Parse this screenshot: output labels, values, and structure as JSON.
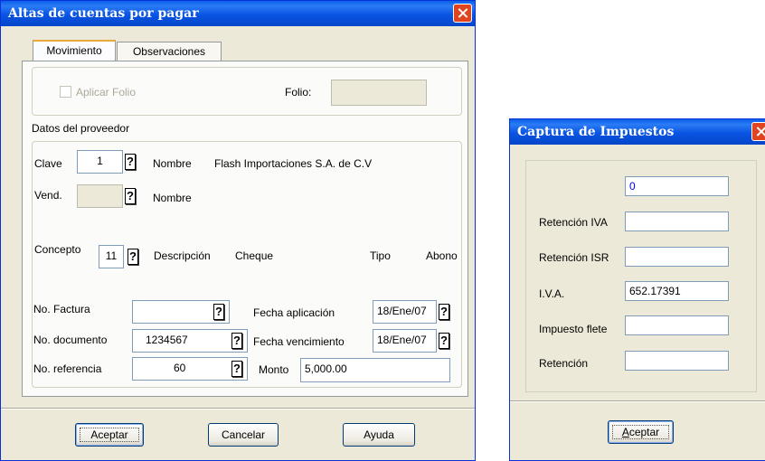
{
  "main_window": {
    "title": "Altas de cuentas por pagar",
    "tabs": [
      "Movimiento",
      "Observaciones"
    ],
    "aplicar_folio_label": "Aplicar Folio",
    "folio_label": "Folio:",
    "folio_value": "",
    "proveedor_section": "Datos del proveedor",
    "clave_label": "Clave",
    "clave_value": "1",
    "nombre_label": "Nombre",
    "nombre_value": "Flash Importaciones S.A. de C.V",
    "vend_label": "Vend.",
    "vend_value": "",
    "vend_nombre_label": "Nombre",
    "concepto_label": "Concepto",
    "concepto_value": "11",
    "descripcion_label": "Descripción",
    "descripcion_value": "Cheque",
    "tipo_label": "Tipo",
    "tipo_value": "Abono",
    "factura_label": "No. Factura",
    "factura_value": "",
    "documento_label": "No. documento",
    "documento_value": "1234567",
    "referencia_label": "No. referencia",
    "referencia_value": "60",
    "fecha_aplicacion_label": "Fecha aplicación",
    "fecha_aplicacion_value": "18/Ene/07",
    "fecha_vencimiento_label": "Fecha vencimiento",
    "fecha_vencimiento_value": "18/Ene/07",
    "monto_label": "Monto",
    "monto_value": "5,000.00",
    "help_glyph": "?",
    "buttons": {
      "accept": "Aceptar",
      "cancel": "Cancelar",
      "help": "Ayuda"
    }
  },
  "tax_dialog": {
    "title": "Captura de Impuestos",
    "first_value": "0",
    "retencion_iva_label": "Retención IVA",
    "retencion_iva_value": "",
    "retencion_isr_label": "Retención ISR",
    "retencion_isr_value": "",
    "iva_label": "I.V.A.",
    "iva_value": "652.17391",
    "impuesto_flete_label": "Impuesto flete",
    "impuesto_flete_value": "",
    "retencion_label": "Retención",
    "retencion_value": "",
    "accept_label_first": "A",
    "accept_label_rest": "ceptar"
  },
  "colors": {
    "title_bar": "#0954e2",
    "close_button": "#e0451f",
    "window_bg": "#ece9d8"
  }
}
